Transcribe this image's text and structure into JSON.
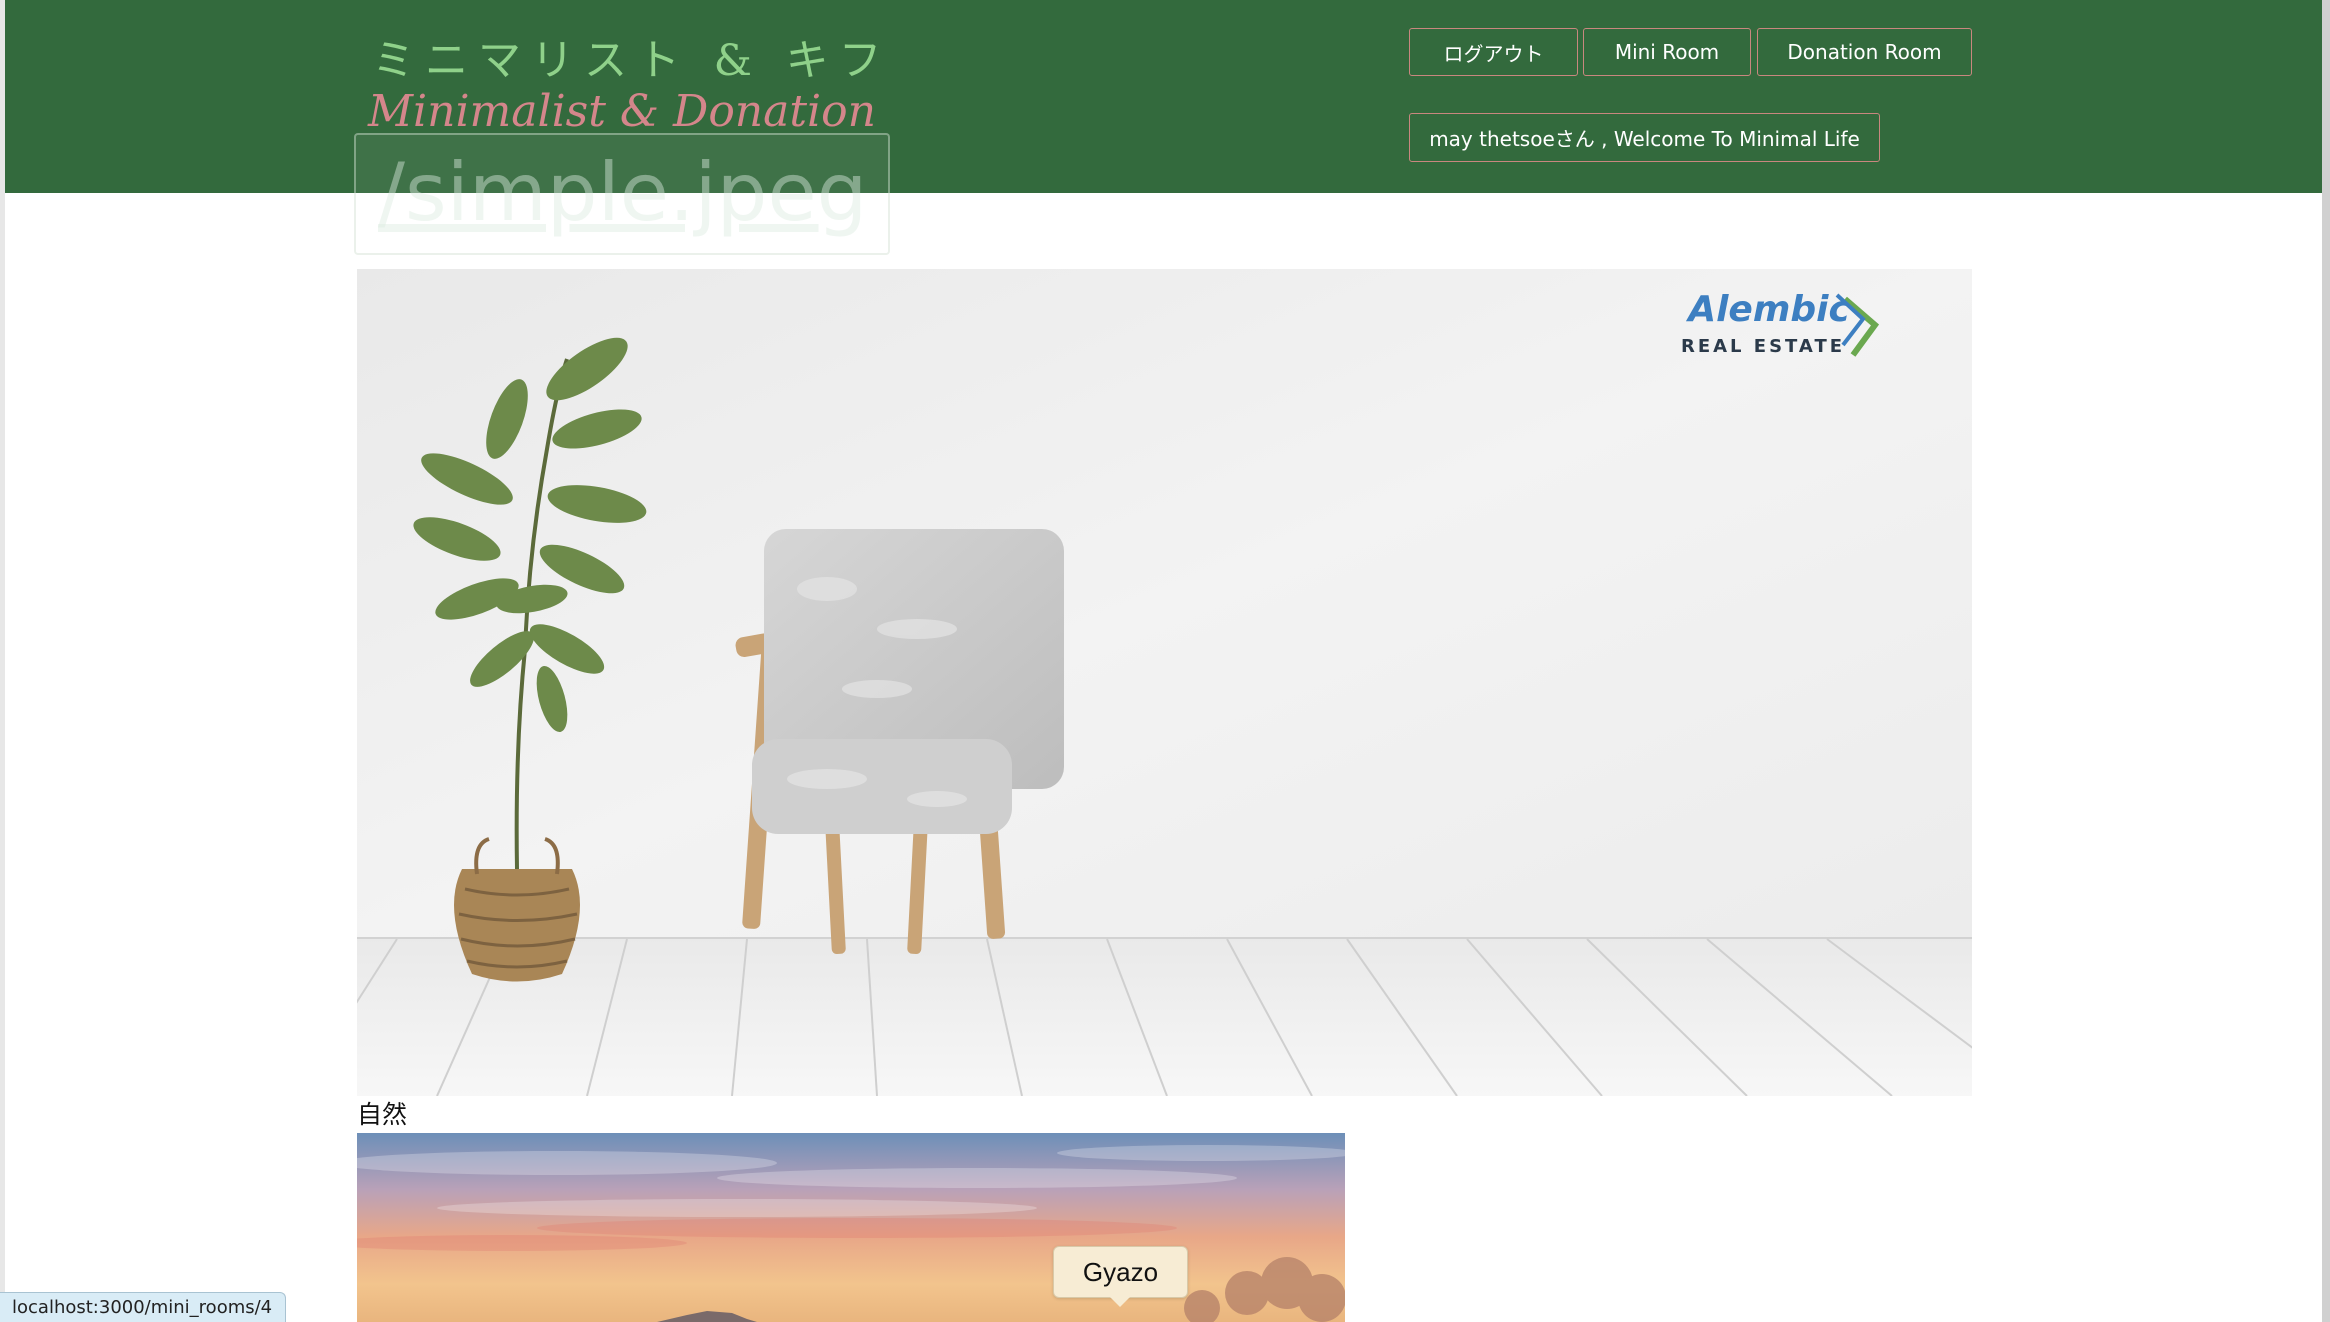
{
  "header": {
    "logo_jp": "ミニマリスト & キフ",
    "logo_en": "Minimalist & Donation",
    "broken_image_alt": "/simple.jpeg",
    "nav": {
      "logout_label": "ログアウト",
      "mini_room_label": "Mini Room",
      "donation_room_label": "Donation Room"
    },
    "welcome_label": "may thetsoeさん , Welcome To Minimal Life"
  },
  "hero": {
    "watermark_brand": "Alembic",
    "watermark_sub": "REAL ESTATE"
  },
  "content": {
    "nature_caption": "自然"
  },
  "tooltip": {
    "label": "Gyazo"
  },
  "status_bar": {
    "url": "localhost:3000/mini_rooms/4"
  },
  "colors": {
    "header_bg": "#336a3d",
    "logo_jp": "#8fd18a",
    "logo_en": "#d4868b",
    "button_border": "#c9877f"
  }
}
